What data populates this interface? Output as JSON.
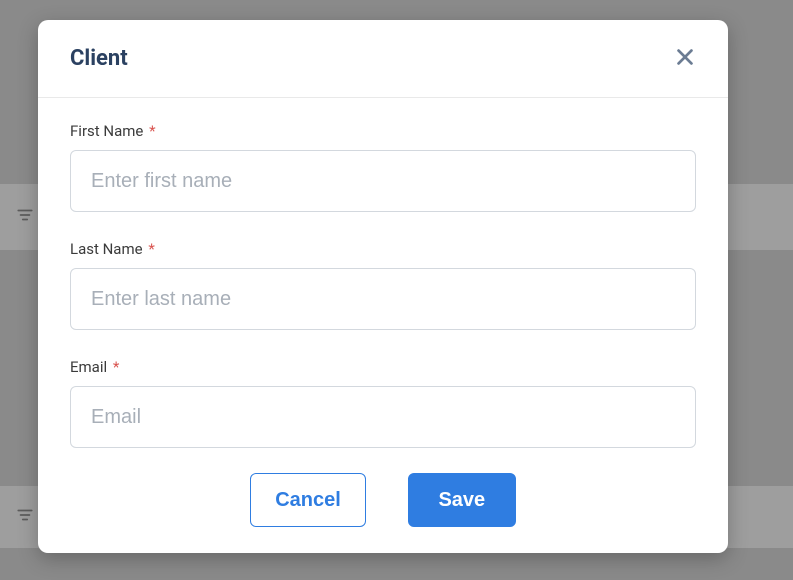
{
  "modal": {
    "title": "Client",
    "fields": {
      "first_name": {
        "label": "First Name",
        "required_mark": "*",
        "placeholder": "Enter first name",
        "value": ""
      },
      "last_name": {
        "label": "Last Name",
        "required_mark": "*",
        "placeholder": "Enter last name",
        "value": ""
      },
      "email": {
        "label": "Email",
        "required_mark": "*",
        "placeholder": "Email",
        "value": ""
      }
    },
    "buttons": {
      "cancel": "Cancel",
      "save": "Save"
    }
  }
}
